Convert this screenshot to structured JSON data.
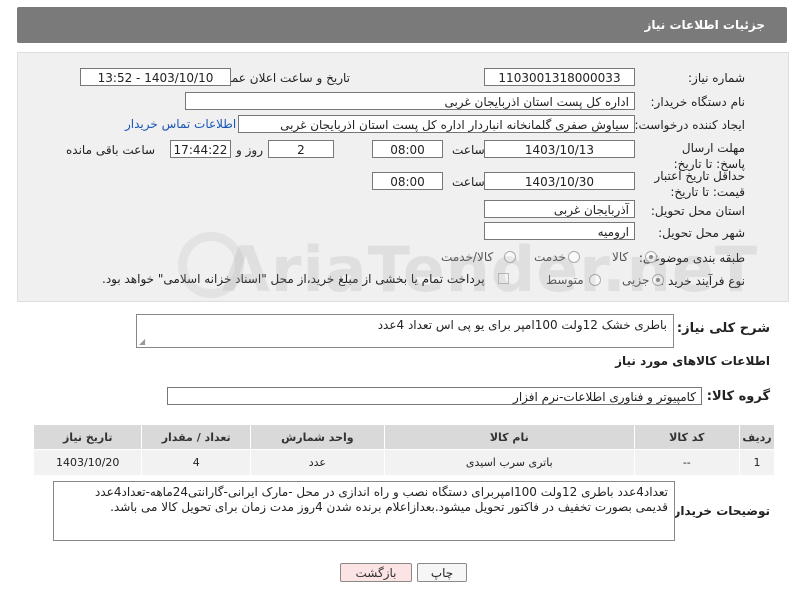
{
  "header": {
    "title": "جزئیات اطلاعات نیاز"
  },
  "form": {
    "need_number": {
      "label": "شماره نیاز:",
      "value": "1103001318000033"
    },
    "announce_datetime": {
      "label": "تاریخ و ساعت اعلان عمومی:",
      "value": "1403/10/10 - 13:52"
    },
    "buyer_org": {
      "label": "نام دستگاه خریدار:",
      "value": "اداره کل پست استان اذربایجان غربی"
    },
    "requester": {
      "label": "ایجاد کننده درخواست:",
      "value": "سیاوش صفری گلمانخانه انباردار اداره کل پست استان اذربایجان غربی",
      "contact_link": "اطلاعات تماس خریدار"
    },
    "reply_deadline": {
      "label": "مهلت ارسال پاسخ: تا تاریخ:",
      "date": "1403/10/13",
      "time_label": "ساعت",
      "time": "08:00",
      "days": "2",
      "days_label": "روز و",
      "remaining": "17:44:22",
      "remaining_label": "ساعت باقی مانده"
    },
    "price_validity": {
      "label": "حداقل تاریخ اعتبار قیمت: تا تاریخ:",
      "date": "1403/10/30",
      "time_label": "ساعت",
      "time": "08:00"
    },
    "delivery_province": {
      "label": "استان محل تحویل:",
      "value": "آذربایجان غربی"
    },
    "delivery_city": {
      "label": "شهر محل تحویل:",
      "value": "ارومیه"
    },
    "category": {
      "label": "طبقه بندی موضوعی:",
      "options": [
        "کالا",
        "خدمت",
        "کالا/خدمت"
      ],
      "selected": "کالا"
    },
    "process": {
      "label": "نوع فرآیند خرید :",
      "options": [
        "جزیی",
        "متوسط"
      ],
      "selected": "جزیی",
      "payment_note": "پرداخت تمام یا بخشی از مبلغ خرید،از محل \"اسناد خزانه اسلامی\" خواهد بود."
    }
  },
  "description": {
    "label": "شرح کلی نیاز:",
    "value": "باطری خشک 12ولت 100امپر برای یو پی اس تعداد 4عدد"
  },
  "goods_info": {
    "section_title": "اطلاعات کالاهای مورد نیاز",
    "group_label": "گروه کالا:",
    "group_value": "کامپیوتر و فناوری اطلاعات-نرم افزار",
    "columns": [
      "ردیف",
      "کد کالا",
      "نام کالا",
      "واحد شمارش",
      "تعداد / مقدار",
      "تاریخ نیاز"
    ],
    "rows": [
      {
        "row": "1",
        "code": "--",
        "name": "باتری سرب اسیدی",
        "unit": "عدد",
        "qty": "4",
        "date": "1403/10/20"
      }
    ]
  },
  "buyer_notes": {
    "label": "توضیحات خریدار:",
    "value": "تعداد4عدد باطری 12ولت 100امپربرای دستگاه نصب و راه اندازی در محل -مارک ایرانی-گارانتی24ماهه-تعداد4عدد قدیمی بصورت تخفیف در فاکتور تحویل میشود.بعدازاعلام برنده شدن 4روز مدت زمان برای تحویل کالا می باشد."
  },
  "buttons": {
    "print": "چاپ",
    "back": "بازگشت"
  },
  "watermark": {
    "text": "AriaTender.neT"
  }
}
